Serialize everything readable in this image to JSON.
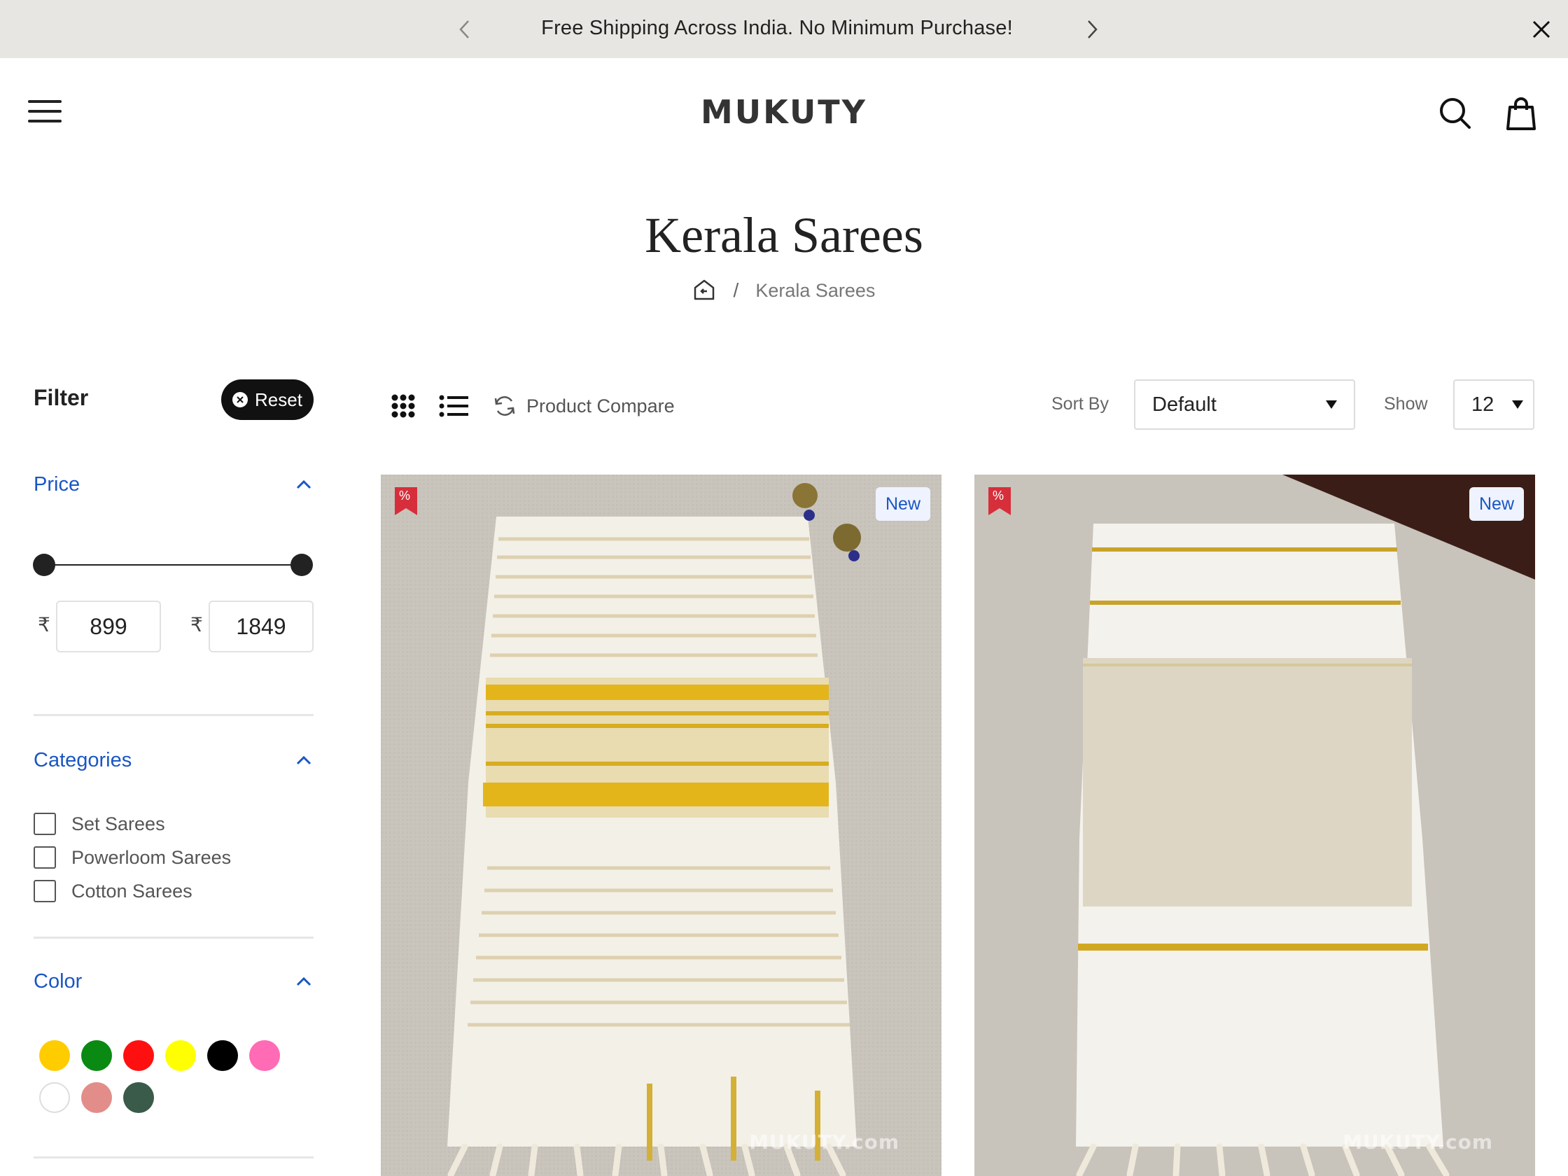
{
  "announcement": {
    "message": "Free Shipping Across India. No Minimum Purchase!"
  },
  "header": {
    "logo": "MUKUTY"
  },
  "page": {
    "title": "Kerala Sarees"
  },
  "breadcrumb": {
    "current": "Kerala Sarees",
    "separator": "/"
  },
  "filter": {
    "title": "Filter",
    "reset_label": "Reset",
    "price": {
      "label": "Price",
      "currency": "₹",
      "min": "899",
      "max": "1849"
    },
    "categories": {
      "label": "Categories",
      "items": [
        {
          "label": "Set Sarees"
        },
        {
          "label": "Powerloom Sarees"
        },
        {
          "label": "Cotton Sarees"
        }
      ]
    },
    "color": {
      "label": "Color",
      "swatches": [
        "#ffcc00",
        "#0a8a12",
        "#ff1010",
        "#ffff00",
        "#000000",
        "#ff6bb5",
        "#ffffff",
        "#e38d8a",
        "#3a5a4a"
      ]
    }
  },
  "toolbar": {
    "compare_label": "Product Compare",
    "sort_label": "Sort By",
    "sort_value": "Default",
    "show_label": "Show",
    "show_value": "12"
  },
  "products": [
    {
      "badge": "New",
      "sale_symbol": "%",
      "watermark": "MUKUTY.com"
    },
    {
      "badge": "New",
      "sale_symbol": "%",
      "watermark": "MUKUTY.com"
    }
  ]
}
